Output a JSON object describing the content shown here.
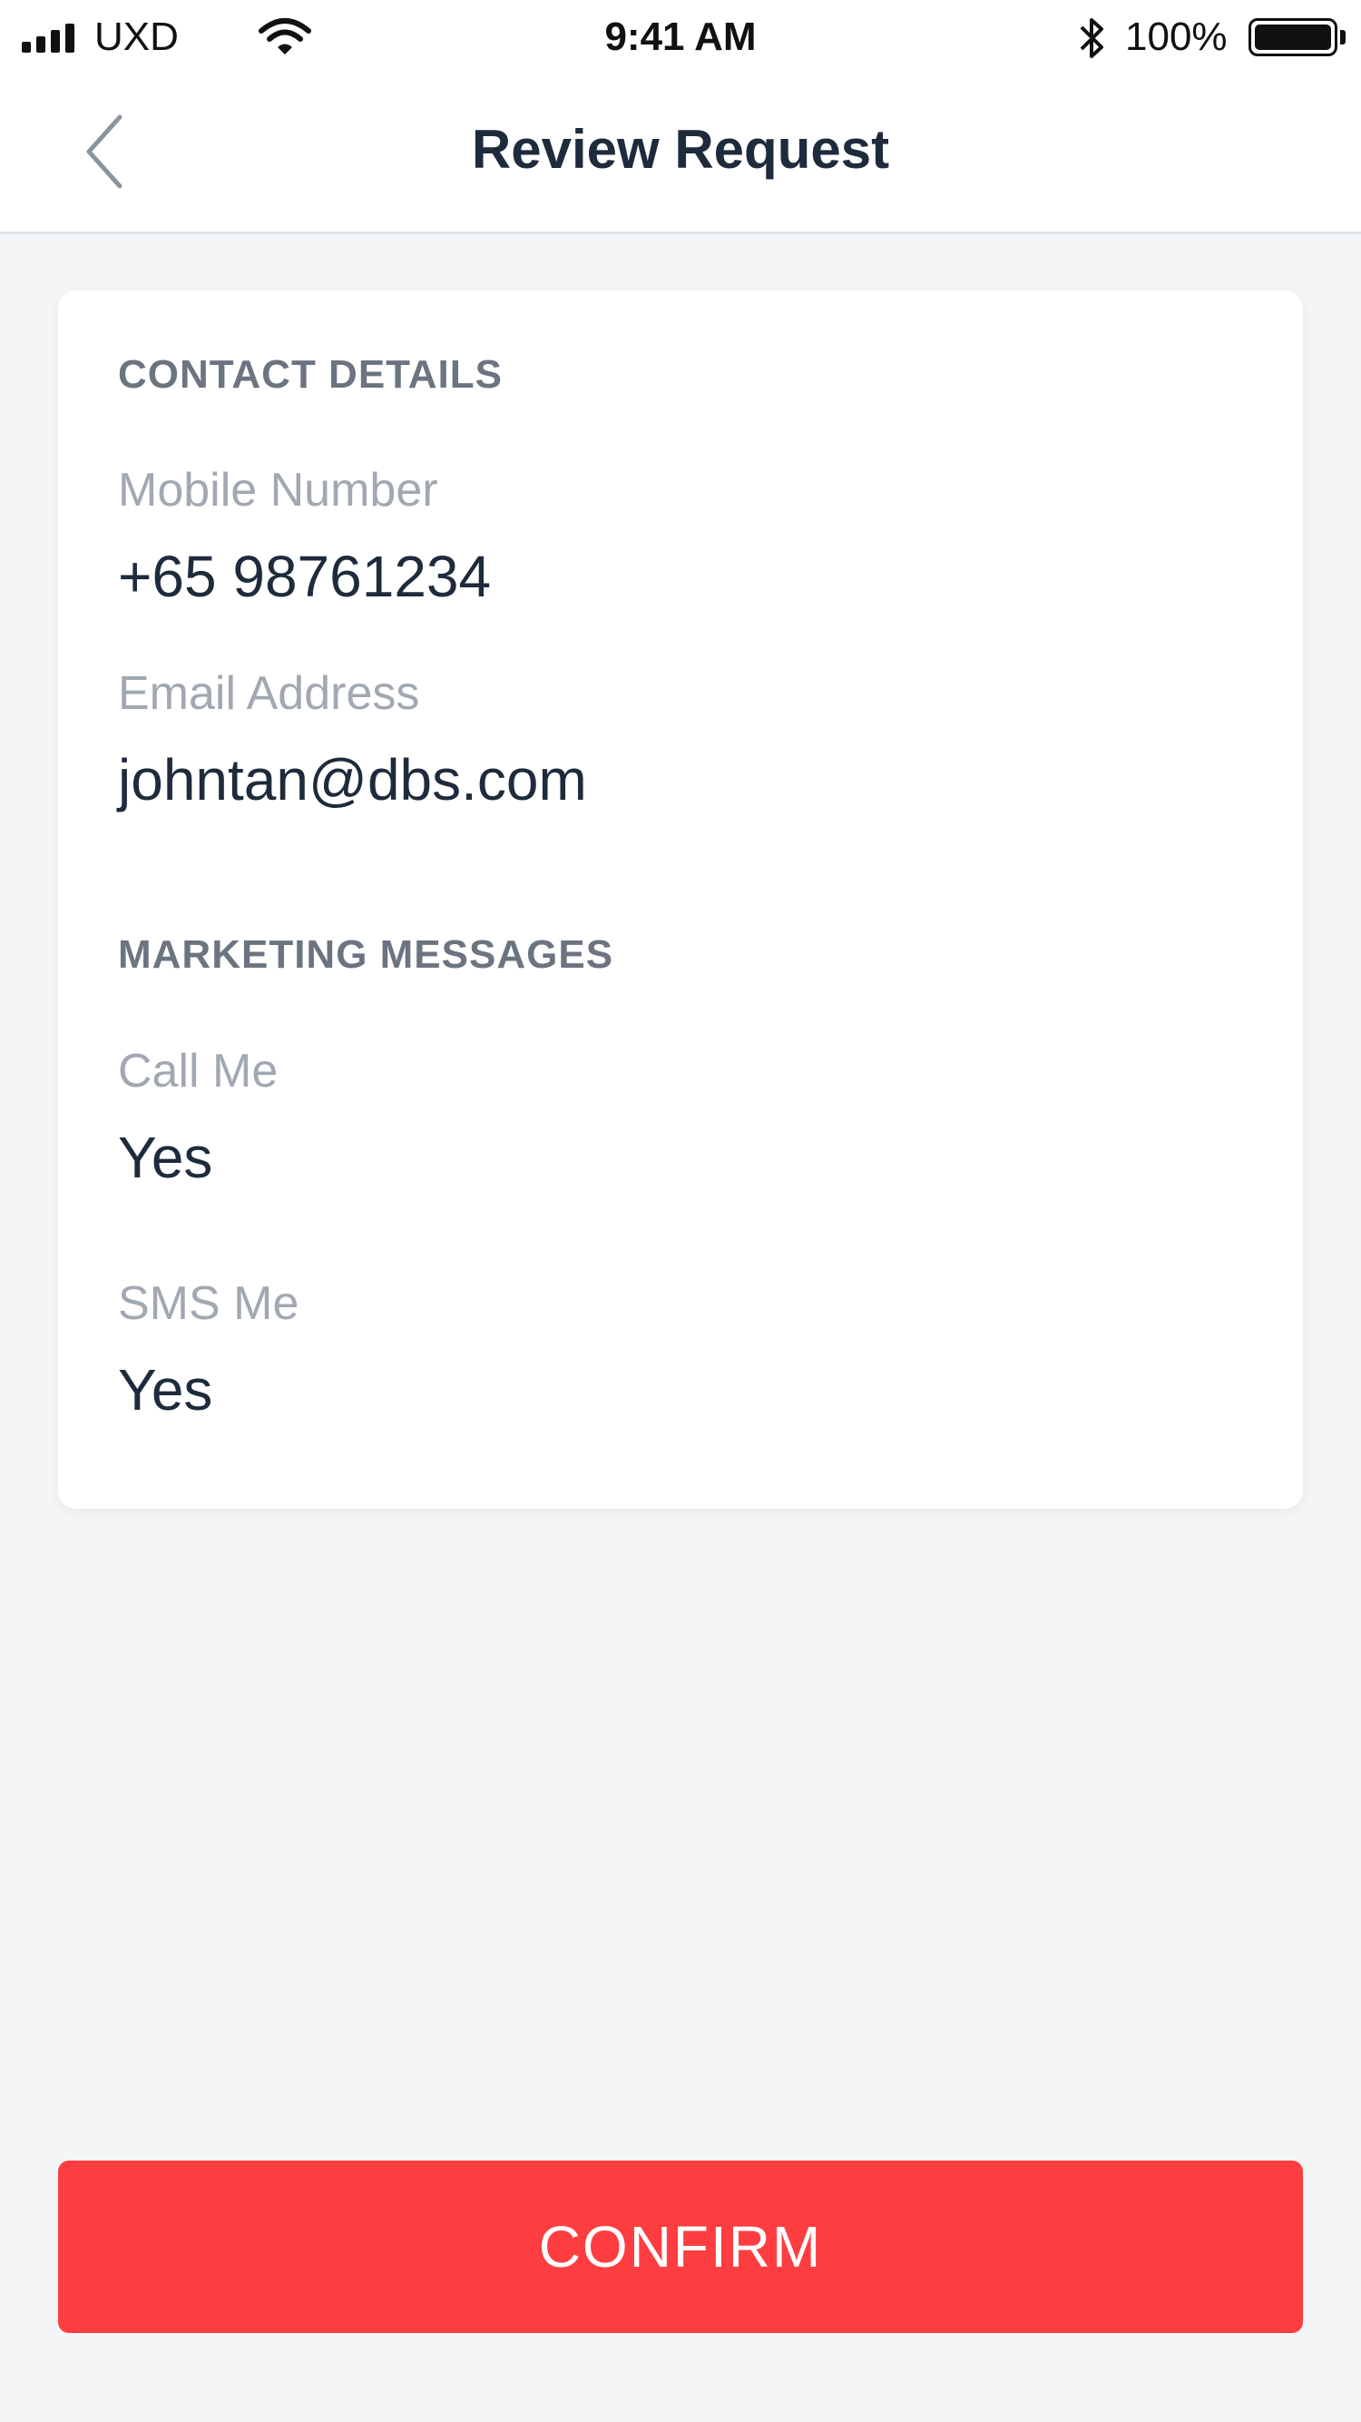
{
  "status_bar": {
    "carrier": "UXD",
    "time": "9:41 AM",
    "battery_percent": "100%",
    "icons": [
      "signal-icon",
      "wifi-icon",
      "bluetooth-icon",
      "battery-icon"
    ]
  },
  "nav": {
    "title": "Review Request",
    "back_icon": "chevron-left-icon"
  },
  "contact": {
    "heading": "CONTACT DETAILS",
    "mobile_label": "Mobile Number",
    "mobile_value": "+65 98761234",
    "email_label": "Email Address",
    "email_value": "johntan@dbs.com"
  },
  "marketing": {
    "heading": "MARKETING MESSAGES",
    "call_label": "Call Me",
    "call_value": "Yes",
    "sms_label": "SMS Me",
    "sms_value": "Yes"
  },
  "actions": {
    "confirm_label": "CONFIRM"
  },
  "colors": {
    "accent": "#fe3d41",
    "background": "#f4f5f7",
    "text_primary": "#1e2b3c",
    "text_secondary": "#a1a8b2"
  }
}
